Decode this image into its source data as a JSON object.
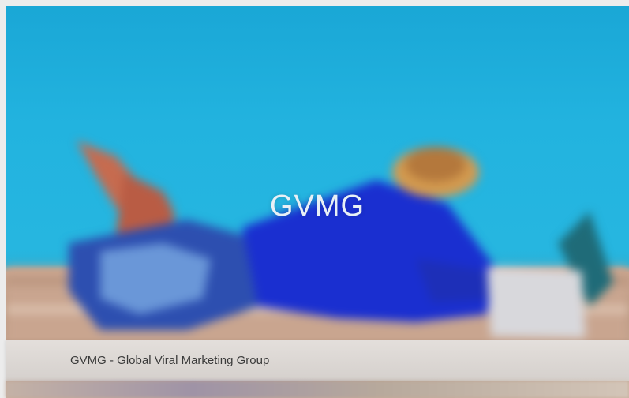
{
  "hero": {
    "title": "GVMG",
    "image_alt": "person lying on poolside deck using a laptop"
  },
  "caption": {
    "text": "GVMG - Global Viral Marketing Group"
  },
  "colors": {
    "sky_blue": "#26b6e0",
    "shirt_blue": "#1a2fd0",
    "deck": "#c9a58f",
    "caption_bg": "#dcdad8",
    "caption_text": "#3a3a3a"
  }
}
